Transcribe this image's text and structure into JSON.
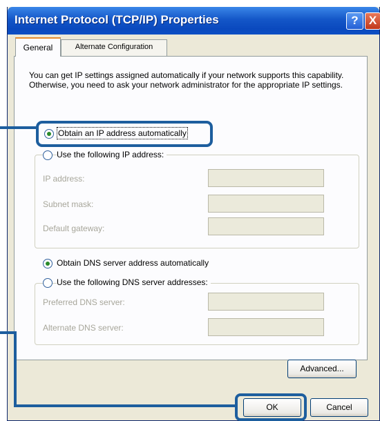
{
  "window": {
    "title": "Internet Protocol (TCP/IP) Properties",
    "help_icon": "?",
    "close_icon": "X"
  },
  "tabs": [
    {
      "label": "General"
    },
    {
      "label": "Alternate Configuration"
    }
  ],
  "description": "You can get IP settings assigned automatically if your network supports this capability. Otherwise, you need to ask your network administrator for the appropriate IP settings.",
  "ip": {
    "obtain_auto_label": "Obtain an IP address automatically",
    "use_following_label": "Use the following IP address:",
    "selected": "obtain_auto",
    "fields": [
      {
        "label": "IP address:",
        "value": ""
      },
      {
        "label": "Subnet mask:",
        "value": ""
      },
      {
        "label": "Default gateway:",
        "value": ""
      }
    ]
  },
  "dns": {
    "obtain_auto_label": "Obtain DNS server address automatically",
    "use_following_label": "Use the following DNS server addresses:",
    "selected": "obtain_auto",
    "fields": [
      {
        "label": "Preferred DNS server:",
        "value": ""
      },
      {
        "label": "Alternate DNS server:",
        "value": ""
      }
    ]
  },
  "buttons": {
    "advanced": "Advanced...",
    "ok": "OK",
    "cancel": "Cancel"
  },
  "colors": {
    "titlebar": "#0a49be",
    "annotation": "#1d5e9e",
    "dialog_bg": "#ece9d8"
  }
}
